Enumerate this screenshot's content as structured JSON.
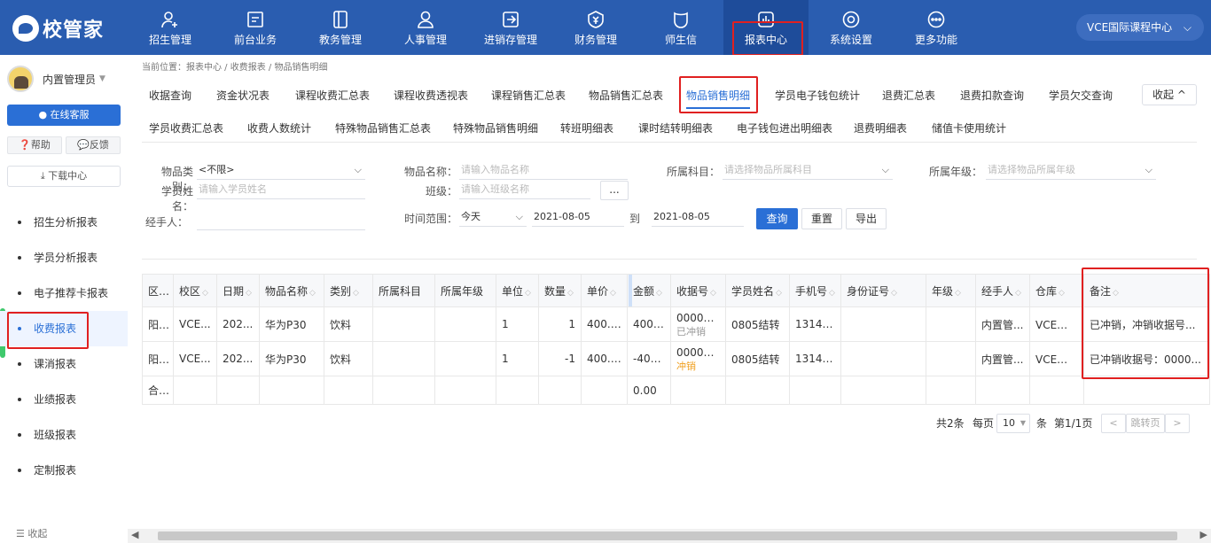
{
  "app": {
    "logo_text": "校管家",
    "org": "VCE国际课程中心"
  },
  "nav": [
    {
      "label": "招生管理",
      "icon": "user-plus-icon"
    },
    {
      "label": "前台业务",
      "icon": "desk-icon"
    },
    {
      "label": "教务管理",
      "icon": "book-icon"
    },
    {
      "label": "人事管理",
      "icon": "person-icon"
    },
    {
      "label": "进销存管理",
      "icon": "inventory-icon"
    },
    {
      "label": "财务管理",
      "icon": "finance-icon"
    },
    {
      "label": "师生信",
      "icon": "message-icon"
    },
    {
      "label": "报表中心",
      "icon": "report-icon"
    },
    {
      "label": "系统设置",
      "icon": "settings-icon"
    },
    {
      "label": "更多功能",
      "icon": "more-icon"
    }
  ],
  "sidebar": {
    "user": "内置管理员",
    "online_service": "在线客服",
    "help": "帮助",
    "feedback": "反馈",
    "download": "下载中心",
    "items": [
      "招生分析报表",
      "学员分析报表",
      "电子推荐卡报表",
      "收费报表",
      "课消报表",
      "业绩报表",
      "班级报表",
      "定制报表"
    ],
    "collapse": "收起"
  },
  "breadcrumb": "当前位置：报表中心 / 收费报表 / 物品销售明细",
  "tabs_row1": [
    "收据查询",
    "资金状况表",
    "课程收费汇总表",
    "课程收费透视表",
    "课程销售汇总表",
    "物品销售汇总表",
    "物品销售明细",
    "学员电子钱包统计",
    "退费汇总表",
    "退费扣款查询",
    "学员欠交查询"
  ],
  "tabs_row2": [
    "学员收费汇总表",
    "收费人数统计",
    "特殊物品销售汇总表",
    "特殊物品销售明细",
    "转班明细表",
    "课时结转明细表",
    "电子钱包进出明细表",
    "退费明细表",
    "储值卡使用统计"
  ],
  "fold_label": "收起",
  "filters": {
    "category_label": "物品类别：",
    "category_value": "<不限>",
    "item_name_label": "物品名称：",
    "item_name_placeholder": "请输入物品名称",
    "subject_label": "所属科目：",
    "subject_placeholder": "请选择物品所属科目",
    "grade_label": "所属年级：",
    "grade_placeholder": "请选择物品所属年级",
    "student_label": "学员姓名：",
    "student_placeholder": "请输入学员姓名",
    "class_label": "班级：",
    "class_placeholder": "请输入班级名称",
    "class_btn": "...",
    "handler_label": "经手人：",
    "time_label": "时间范围：",
    "time_value": "今天",
    "date_from": "2021-08-05",
    "to": "到",
    "date_to": "2021-08-05",
    "query": "查询",
    "reset": "重置",
    "export": "导出"
  },
  "table": {
    "headers": [
      "区域",
      "校区",
      "日期",
      "物品名称",
      "类别",
      "所属科目",
      "所属年级",
      "单位",
      "数量",
      "单价",
      "金额",
      "收据号",
      "学员姓名",
      "手机号",
      "身份证号",
      "年级",
      "经手人",
      "仓库",
      "备注"
    ],
    "rows": [
      {
        "area": "阳光...",
        "campus": "VCE...",
        "date": "202...",
        "item": "华为P30",
        "category": "饮料",
        "subject": "",
        "grade_item": "",
        "unit": "1",
        "qty": "1",
        "price": "400.00",
        "amount": "400....",
        "receipt": "000090...",
        "receipt_sub": "已冲销",
        "student": "0805结转",
        "phone": "13144...",
        "id_no": "",
        "grade": "",
        "handler": "内置管...",
        "warehouse": "VCE国际...",
        "remark": "已冲销，冲销收据号..."
      },
      {
        "area": "阳光...",
        "campus": "VCE...",
        "date": "202...",
        "item": "华为P30",
        "category": "饮料",
        "subject": "",
        "grade_item": "",
        "unit": "1",
        "qty": "-1",
        "price": "400.00",
        "amount": "-400...",
        "receipt": "000090...",
        "receipt_sub": "冲销",
        "student": "0805结转",
        "phone": "13144...",
        "id_no": "",
        "grade": "",
        "handler": "内置管...",
        "warehouse": "VCE国际...",
        "remark": "已冲销收据号：0000..."
      }
    ],
    "total_label": "合计",
    "total_amount": "0.00"
  },
  "pager": {
    "total": "共2条",
    "per_page_label": "每页",
    "per_page": "10",
    "unit": "条",
    "page": "第1/1页",
    "jump": "跳转页"
  }
}
